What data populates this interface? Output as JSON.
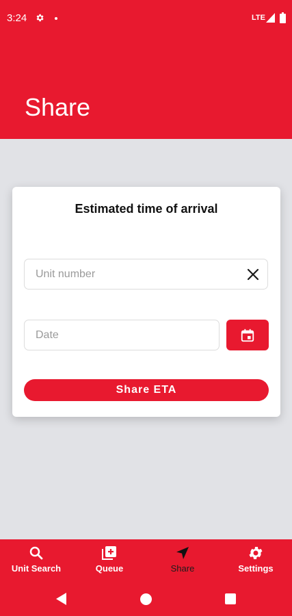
{
  "status_bar": {
    "time": "3:24",
    "network": "LTE",
    "icons": [
      "settings-icon",
      "notification-dot-icon",
      "signal-icon",
      "battery-icon"
    ]
  },
  "header": {
    "title": "Share"
  },
  "card": {
    "title": "Estimated time of arrival",
    "unit_field": {
      "placeholder": "Unit number",
      "value": ""
    },
    "date_field": {
      "placeholder": "Date",
      "value": ""
    },
    "share_button_label": "Share ETA"
  },
  "bottom_nav": {
    "items": [
      {
        "label": "Unit Search",
        "icon": "search-icon"
      },
      {
        "label": "Queue",
        "icon": "queue-add-icon"
      },
      {
        "label": "Share",
        "icon": "navigation-arrow-icon",
        "active": true
      },
      {
        "label": "Settings",
        "icon": "gear-icon"
      }
    ]
  },
  "colors": {
    "primary": "#e8192f",
    "background": "#e1e2e6",
    "card": "#ffffff",
    "active_nav_label": "#1c1c1c"
  }
}
